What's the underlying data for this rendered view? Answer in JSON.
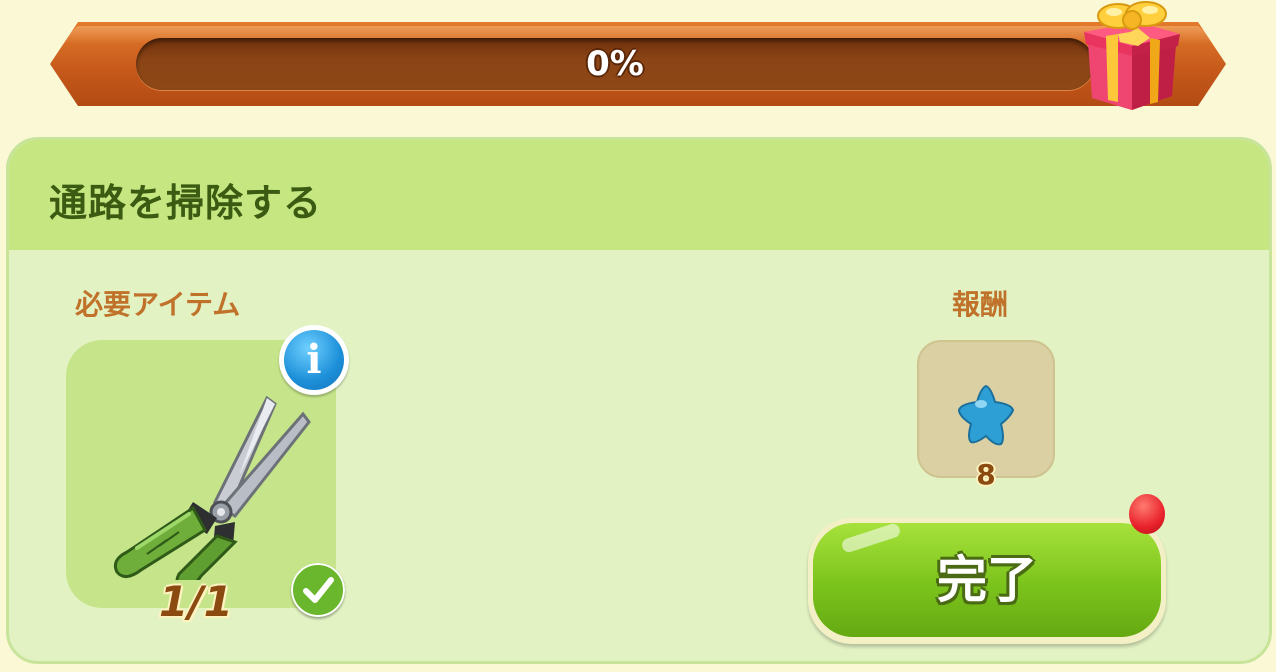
{
  "progress": {
    "label": "0%",
    "value": 0.0
  },
  "task": {
    "title": "通路を掃除する",
    "required_label": "必要アイテム",
    "reward_label": "報酬",
    "required_item": {
      "icon": "pruning-shears-icon",
      "count_text": "1/1",
      "completed": true
    },
    "reward": {
      "icon": "blue-star-icon",
      "amount": "8"
    },
    "complete_button_label": "完了"
  },
  "colors": {
    "accent_green": "#7bc31c",
    "title_green": "#3b5a12",
    "section_label_orange": "#c0722a",
    "progress_frame_orange": "#c5581a",
    "notification_red": "#e8212b"
  }
}
